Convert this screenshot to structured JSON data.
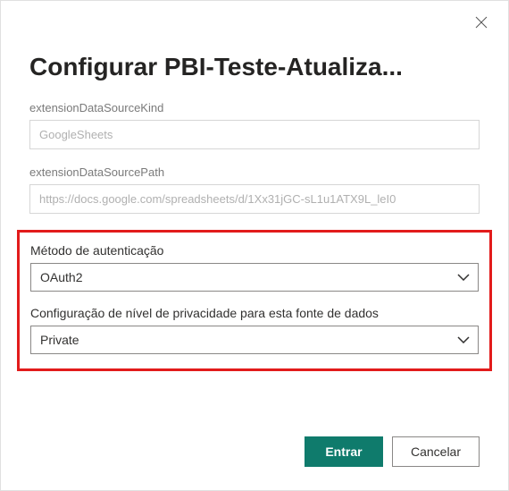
{
  "dialog": {
    "title": "Configurar PBI-Teste-Atualiza...",
    "fields": {
      "kind": {
        "label": "extensionDataSourceKind",
        "value": "GoogleSheets"
      },
      "path": {
        "label": "extensionDataSourcePath",
        "value": "https://docs.google.com/spreadsheets/d/1Xx31jGC-sL1u1ATX9L_leI0"
      }
    },
    "auth": {
      "method_label": "Método de autenticação",
      "method_value": "OAuth2",
      "privacy_label": "Configuração de nível de privacidade para esta fonte de dados",
      "privacy_value": "Private"
    },
    "buttons": {
      "signin": "Entrar",
      "cancel": "Cancelar"
    }
  }
}
